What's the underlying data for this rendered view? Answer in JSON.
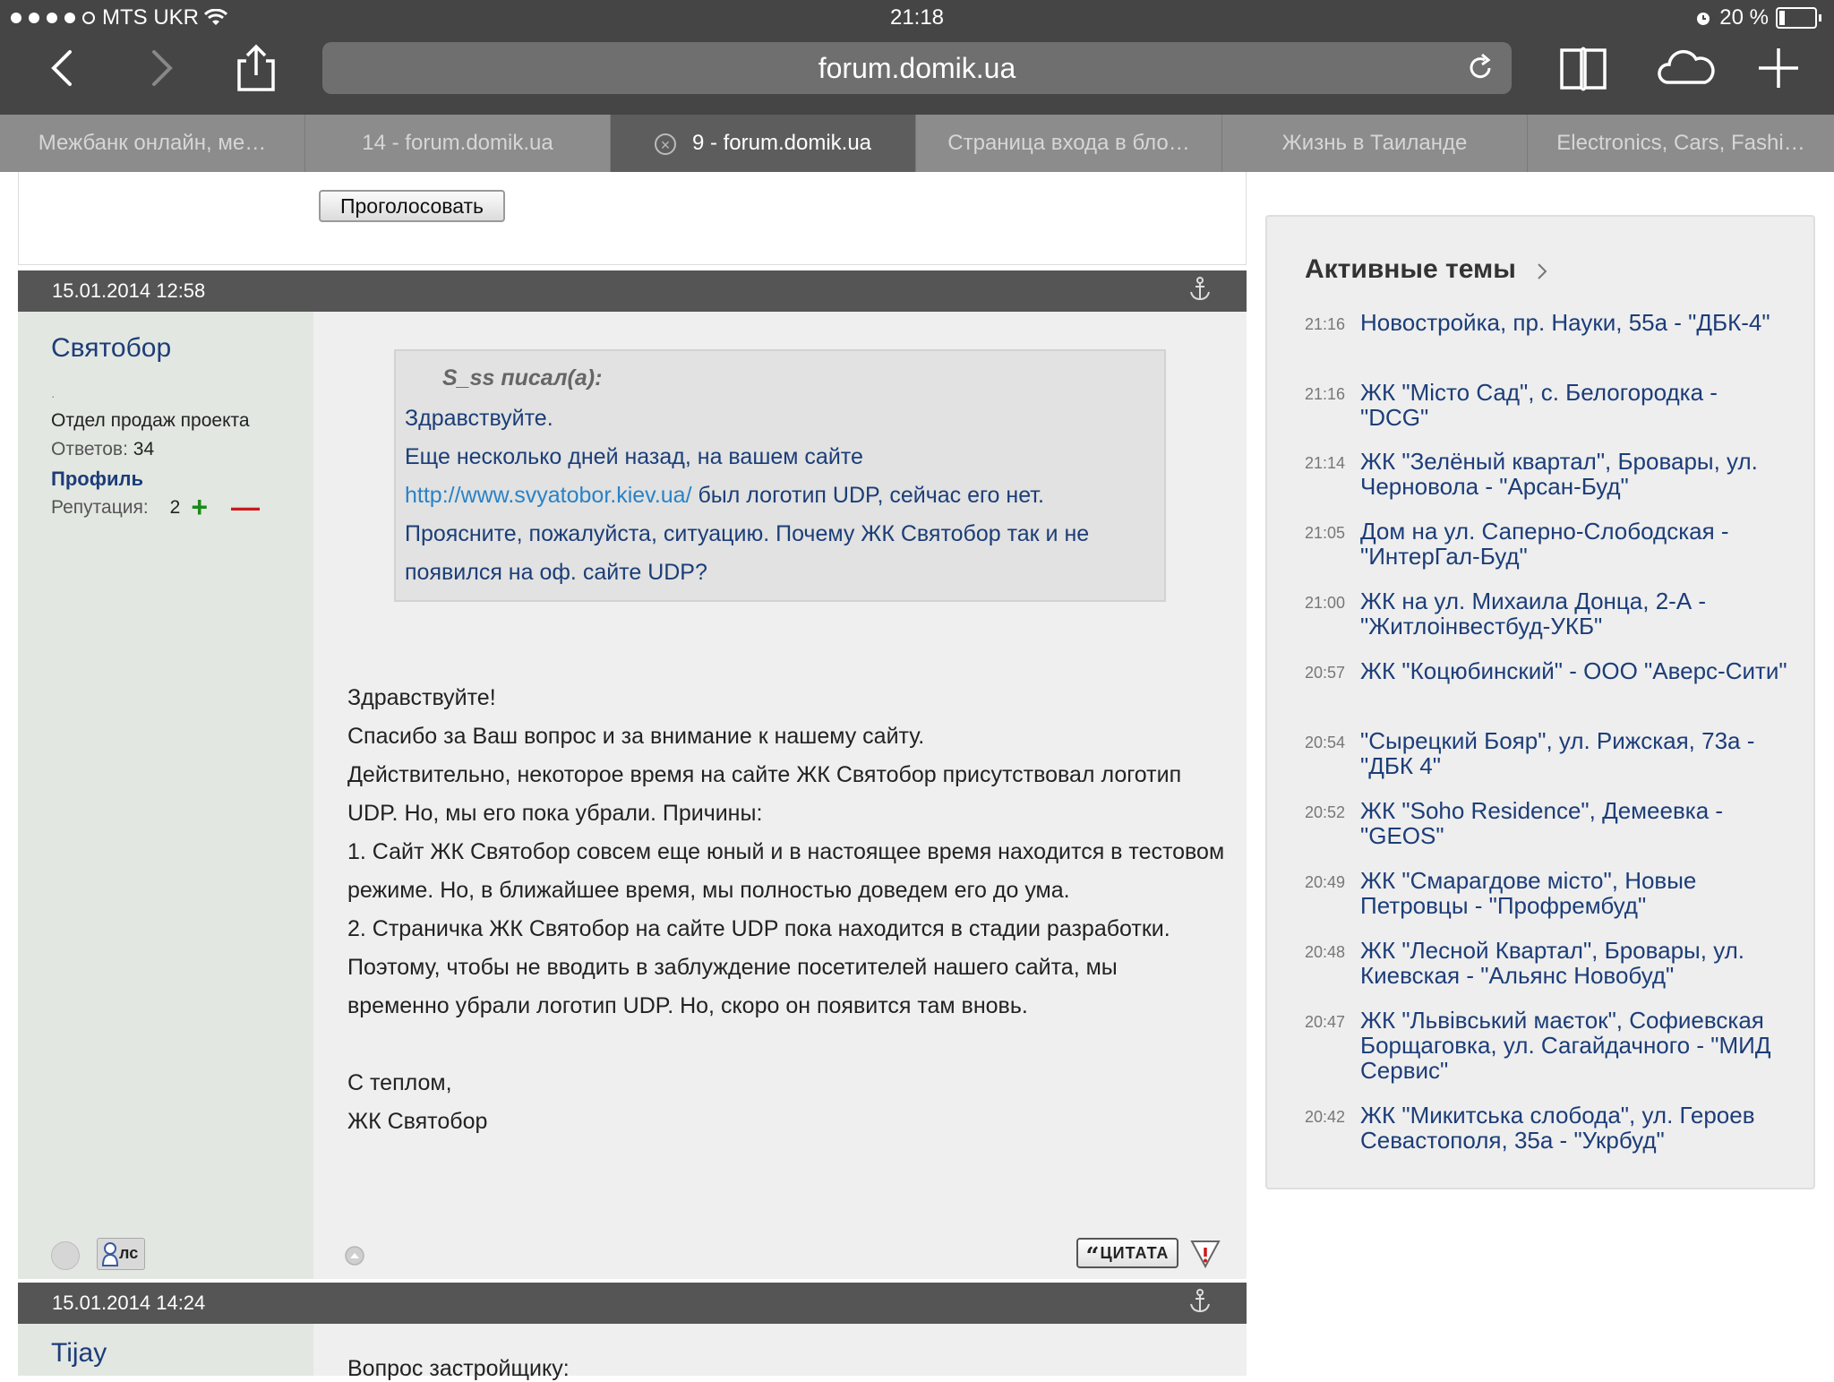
{
  "status_bar": {
    "carrier": "MTS UKR",
    "time": "21:18",
    "battery": "20 %"
  },
  "browser": {
    "url": "forum.domik.ua",
    "tabs": [
      {
        "label": "Межбанк онлайн, ме…",
        "active": false
      },
      {
        "label": "14 - forum.domik.ua",
        "active": false
      },
      {
        "label": "9 - forum.domik.ua",
        "active": true
      },
      {
        "label": "Страница входа в бло…",
        "active": false
      },
      {
        "label": "Жизнь в Таиланде",
        "active": false
      },
      {
        "label": "Electronics, Cars, Fashi…",
        "active": false
      }
    ]
  },
  "poll": {
    "vote_label": "Проголосовать"
  },
  "post1": {
    "date": "15.01.2014 12:58",
    "author": "Святобор",
    "dot": "·",
    "role": "Отдел продаж проекта",
    "answers_label": "Ответов:",
    "answers_count": "34",
    "profile_label": "Профиль",
    "reputation_label": "Репутация:",
    "reputation_value": "2",
    "rep_plus": "+",
    "rep_minus": "—",
    "quote": {
      "author": "S_ss писал(а):",
      "line1": "Здравствуйте.",
      "line2": "Еще несколько дней назад, на вашем сайте",
      "link": "http://www.svyatobor.kiev.ua/",
      "line3_rest": " был логотип UDP, сейчас его нет.",
      "line4": "Проясните, пожалуйста, ситуацию. Почему ЖК Святобор так и не появился на оф. сайте UDP?"
    },
    "body": [
      "Здравствуйте!",
      "Спасибо за Ваш вопрос и за внимание к нашему сайту.",
      "Действительно, некоторое время на сайте ЖК Святобор присутствовал логотип UDP. Но, мы его пока убрали. Причины:",
      "1. Сайт ЖК Святобор совсем еще юный и в настоящее время находится в тестовом режиме. Но, в ближайшее время, мы полностью доведем его до ума.",
      "2. Страничка ЖК Святобор на сайте UDP пока находится в стадии разработки.",
      "Поэтому, чтобы не вводить в заблуждение посетителей нашего сайта, мы временно убрали логотип UDP. Но, скоро он появится там вновь.",
      "",
      "С теплом,",
      "ЖК Святобор"
    ],
    "pm_label": "лс",
    "quote_button_label": "ЦИТАТА"
  },
  "post2": {
    "date": "15.01.2014 14:24",
    "author": "Tijay",
    "body_start": "Вопрос застройщику:"
  },
  "active_topics": {
    "title": "Активные темы",
    "items": [
      {
        "time": "21:16",
        "title": "Новостройка, пр. Науки, 55а - \"ДБК-4\""
      },
      {
        "time": "21:16",
        "title": "ЖК \"Місто Сад\", с. Белогородка - \"DCG\""
      },
      {
        "time": "21:14",
        "title": "ЖК \"Зелёный квартал\", Бровары, ул. Черновола - \"Арсан-Буд\""
      },
      {
        "time": "21:05",
        "title": "Дом на ул. Саперно-Слободская - \"ИнтерГал-Буд\""
      },
      {
        "time": "21:00",
        "title": "ЖК на ул. Михаила Донца, 2-А - \"Житлоінвестбуд-УКБ\""
      },
      {
        "time": "20:57",
        "title": "ЖК \"Коцюбинский\" - ООО \"Аверс-Сити\""
      },
      {
        "time": "20:54",
        "title": "\"Сырецкий Бояр\", ул. Рижская, 73а - \"ДБК 4\""
      },
      {
        "time": "20:52",
        "title": "ЖК \"Soho Residence\", Демеевка - \"GEOS\""
      },
      {
        "time": "20:49",
        "title": "ЖК \"Смарагдове місто\", Новые Петровцы - \"Профрембуд\""
      },
      {
        "time": "20:48",
        "title": "ЖК \"Лесной Квартал\", Бровары, ул. Киевская - \"Альянс Новобуд\""
      },
      {
        "time": "20:47",
        "title": "ЖК \"Львівський маєток\", Софиевская Борщаговка, ул. Сагайдачного - \"МИД Сервис\""
      },
      {
        "time": "20:42",
        "title": "ЖК \"Микитська слобода\", ул. Героев Севастополя, 35а - \"Укрбуд\""
      }
    ]
  }
}
